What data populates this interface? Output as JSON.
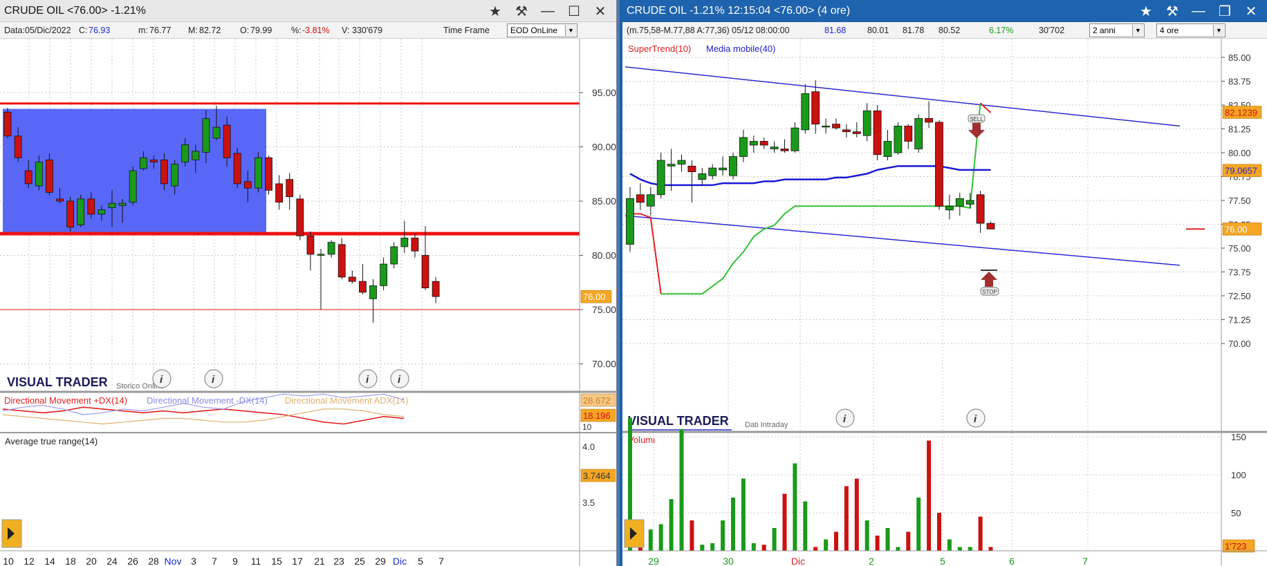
{
  "left": {
    "title": "CRUDE OIL <76.00> -1.21%",
    "info": {
      "data_label": "Data:05/Dic/2022",
      "close_label": "C:",
      "close": "76.93",
      "min_label": "m:",
      "min": "76.77",
      "max_label": "M:",
      "max": "82.72",
      "open_label": "O:",
      "open": "79.99",
      "pct_label": "%:",
      "pct": "-3.81%",
      "vol_label": "V:",
      "vol": "330'679",
      "timeframe_label": "Time Frame",
      "timeframe_value": "EOD OnLine"
    },
    "price_axis": [
      "95.00",
      "90.00",
      "85.00",
      "80.00",
      "75.00",
      "70.00"
    ],
    "price_badge": "76.00",
    "brand": "VISUAL TRADER",
    "brand_sub": "Storico Online",
    "dmi": {
      "plus_label": "Directional Movement +DX(14)",
      "minus_label": "Directional Movement -DX(14)",
      "adx_label": "Directional Movement ADX(14)",
      "badge_top": "28.672",
      "badge_mid": "18.196",
      "axis_10": "10"
    },
    "atr": {
      "label": "Average true range(14)",
      "axis": [
        "4.0",
        "3.5"
      ],
      "badge": "3.7464"
    },
    "x_axis": [
      "10",
      "12",
      "14",
      "18",
      "20",
      "24",
      "26",
      "28",
      "Nov",
      "3",
      "7",
      "9",
      "11",
      "15",
      "17",
      "21",
      "23",
      "25",
      "29",
      "Dic",
      "5",
      "7"
    ],
    "colors": {
      "up": "#1a9a1a",
      "down": "#cc1111",
      "range_box": "#4a5af5",
      "level": "#ee1111",
      "badge": "#f5a623"
    }
  },
  "right": {
    "title": "CRUDE OIL -1.21% 12:15:04  <76.00> (4 ore)",
    "info": {
      "summary": "(m.75,58-M.77,88 A:77,36) 05/12 08:00:00",
      "last": "81.68",
      "v1": "80.01",
      "v2": "81.78",
      "v3": "80.52",
      "pct": "6.17%",
      "vol": "30'702",
      "period_value": "2 anni",
      "interval_value": "4 ore"
    },
    "legend_supertrend": "SuperTrend(10)",
    "legend_ma": "Media mobile(40)",
    "price_axis": [
      "85.00",
      "83.75",
      "82.50",
      "81.25",
      "80.00",
      "78.75",
      "77.50",
      "76.25",
      "75.00",
      "73.75",
      "72.50",
      "71.25",
      "70.00"
    ],
    "badge_top": "82.1239",
    "badge_mid": "79.0657",
    "badge_price": "76.00",
    "sell_label": "SELL",
    "stop_label": "STOP",
    "brand": "VISUAL TRADER",
    "brand_sub": "Dati Intraday",
    "volume_label": "Volumi",
    "volume_axis": [
      "150",
      "100",
      "50"
    ],
    "volume_badge": "1'723",
    "x_axis": [
      "29",
      "30",
      "Dic",
      "2",
      "5",
      "6",
      "7"
    ]
  },
  "chart_data": [
    {
      "type": "candlestick",
      "title": "CRUDE OIL <76.00> -1.21%",
      "x_labels": [
        "10",
        "12",
        "14",
        "18",
        "20",
        "24",
        "26",
        "28",
        "Nov",
        "3",
        "7",
        "9",
        "11",
        "15",
        "17",
        "21",
        "23",
        "25",
        "29",
        "Dic",
        "5",
        "7"
      ],
      "ylim": [
        67.5,
        98.5
      ],
      "levels": [
        94.0,
        82.0,
        75.0
      ],
      "range_box": {
        "from_index": 0,
        "to_index": 24,
        "low": 82.1,
        "high": 93.5
      },
      "ohlc": [
        [
          93.2,
          93.6,
          90.8,
          91.0
        ],
        [
          91.0,
          91.8,
          88.6,
          89.0
        ],
        [
          87.8,
          88.8,
          86.2,
          86.6
        ],
        [
          86.4,
          89.2,
          86.0,
          88.6
        ],
        [
          88.8,
          89.4,
          85.5,
          85.8
        ],
        [
          85.2,
          86.2,
          84.8,
          85.0
        ],
        [
          85.0,
          85.4,
          82.2,
          82.6
        ],
        [
          82.8,
          85.6,
          82.6,
          85.2
        ],
        [
          85.2,
          85.8,
          83.4,
          83.8
        ],
        [
          83.8,
          84.6,
          83.2,
          84.2
        ],
        [
          84.4,
          86.0,
          82.6,
          84.8
        ],
        [
          84.6,
          85.2,
          83.0,
          84.8
        ],
        [
          84.9,
          88.2,
          84.6,
          87.8
        ],
        [
          88.0,
          89.6,
          87.8,
          89.0
        ],
        [
          88.8,
          89.2,
          88.0,
          88.6
        ],
        [
          88.8,
          89.4,
          86.0,
          86.6
        ],
        [
          86.4,
          88.8,
          85.6,
          88.4
        ],
        [
          88.6,
          90.8,
          88.2,
          90.2
        ],
        [
          88.8,
          90.2,
          87.6,
          89.6
        ],
        [
          89.5,
          93.4,
          88.5,
          92.6
        ],
        [
          90.8,
          93.8,
          90.6,
          91.8
        ],
        [
          92.0,
          92.8,
          88.2,
          89.0
        ],
        [
          89.4,
          89.9,
          86.2,
          86.6
        ],
        [
          86.8,
          87.8,
          84.9,
          86.2
        ],
        [
          86.2,
          89.5,
          85.8,
          89.0
        ],
        [
          89.0,
          89.2,
          85.6,
          86.0
        ],
        [
          86.6,
          87.4,
          84.2,
          84.9
        ],
        [
          87.0,
          87.6,
          84.2,
          85.4
        ],
        [
          85.2,
          85.6,
          81.4,
          81.8
        ],
        [
          81.8,
          82.2,
          78.6,
          80.1
        ],
        [
          80.0,
          80.6,
          75.0,
          80.1
        ],
        [
          80.1,
          81.4,
          79.8,
          81.2
        ],
        [
          81.0,
          81.6,
          77.8,
          78.0
        ],
        [
          78.0,
          78.6,
          77.4,
          77.6
        ],
        [
          77.6,
          79.2,
          76.4,
          76.6
        ],
        [
          76.0,
          77.8,
          73.8,
          77.2
        ],
        [
          77.2,
          79.8,
          76.8,
          79.2
        ],
        [
          79.2,
          81.2,
          78.8,
          80.8
        ],
        [
          80.8,
          83.2,
          80.2,
          81.6
        ],
        [
          81.6,
          82.0,
          79.8,
          80.4
        ],
        [
          80.0,
          82.7,
          76.8,
          77.0
        ],
        [
          77.6,
          78.0,
          75.6,
          76.2
        ]
      ]
    },
    {
      "type": "line",
      "title": "Directional Movement",
      "series": [
        {
          "name": "Directional Movement +DX(14)",
          "values": [
            23,
            22,
            21,
            22,
            24,
            23,
            22,
            21,
            22,
            21,
            22,
            23,
            22,
            21,
            20,
            18,
            16,
            15,
            17,
            19,
            18
          ]
        },
        {
          "name": "Directional Movement -DX(14)",
          "values": [
            22,
            24,
            25,
            23,
            20,
            21,
            23,
            22,
            24,
            26,
            24,
            23,
            27,
            29,
            31,
            30,
            31,
            29,
            30,
            31,
            28
          ]
        },
        {
          "name": "Directional Movement ADX(14)",
          "values": [
            20,
            19,
            18,
            17,
            16,
            15,
            16,
            17,
            18,
            18,
            17,
            16,
            16,
            17,
            19,
            21,
            23,
            23,
            22,
            20,
            19
          ]
        }
      ]
    },
    {
      "type": "candlestick",
      "title": "CRUDE OIL -1.21% 12:15:04  <76.00> (4 ore)",
      "x_labels": [
        "29",
        "30",
        "Dic",
        "2",
        "5",
        "6",
        "7"
      ],
      "ylim": [
        69.0,
        85.6
      ],
      "ohlc": [
        [
          75.2,
          78.2,
          74.8,
          77.6
        ],
        [
          77.8,
          78.4,
          77.0,
          77.4
        ],
        [
          77.2,
          78.2,
          76.7,
          77.8
        ],
        [
          77.8,
          80.0,
          77.6,
          79.6
        ],
        [
          79.3,
          80.2,
          78.0,
          79.4
        ],
        [
          79.4,
          79.9,
          79.0,
          79.6
        ],
        [
          79.3,
          79.6,
          77.4,
          79.0
        ],
        [
          78.6,
          79.2,
          78.3,
          78.9
        ],
        [
          78.8,
          79.4,
          78.6,
          79.2
        ],
        [
          79.1,
          79.8,
          78.8,
          79.2
        ],
        [
          78.8,
          80.0,
          78.6,
          79.8
        ],
        [
          79.8,
          81.2,
          79.5,
          80.8
        ],
        [
          80.4,
          80.9,
          80.0,
          80.6
        ],
        [
          80.6,
          80.8,
          80.2,
          80.4
        ],
        [
          80.2,
          80.6,
          80.0,
          80.3
        ],
        [
          80.2,
          80.7,
          80.0,
          80.1
        ],
        [
          80.1,
          81.6,
          80.0,
          81.3
        ],
        [
          81.2,
          83.6,
          81.0,
          83.1
        ],
        [
          83.2,
          83.8,
          81.0,
          81.5
        ],
        [
          81.4,
          81.8,
          81.0,
          81.4
        ],
        [
          81.5,
          81.8,
          81.2,
          81.3
        ],
        [
          81.2,
          81.5,
          80.8,
          81.1
        ],
        [
          81.1,
          81.6,
          80.8,
          81.0
        ],
        [
          80.9,
          82.6,
          80.6,
          82.2
        ],
        [
          82.2,
          82.5,
          79.6,
          79.9
        ],
        [
          79.8,
          81.2,
          79.6,
          80.6
        ],
        [
          80.0,
          81.6,
          79.9,
          81.4
        ],
        [
          81.4,
          81.5,
          80.2,
          80.6
        ],
        [
          80.2,
          82.0,
          80.0,
          81.8
        ],
        [
          81.8,
          82.7,
          81.3,
          81.6
        ],
        [
          81.6,
          81.7,
          77.0,
          77.2
        ],
        [
          77.0,
          77.8,
          76.5,
          77.2
        ],
        [
          77.2,
          77.9,
          76.7,
          77.6
        ],
        [
          77.3,
          77.9,
          77.1,
          77.5
        ],
        [
          77.8,
          78.0,
          75.8,
          76.3
        ],
        [
          76.3,
          76.4,
          76.0,
          76.0
        ]
      ],
      "series": [
        {
          "name": "SuperTrend(10)",
          "values": [
            76.8,
            76.8,
            76.6,
            72.6,
            72.6,
            72.6,
            72.6,
            72.6,
            73.0,
            73.4,
            74.2,
            74.8,
            75.6,
            76.0,
            76.2,
            76.8,
            77.2,
            77.2,
            77.2,
            77.2,
            77.2,
            77.2,
            77.2,
            77.2,
            77.2,
            77.2,
            77.2,
            77.2,
            77.2,
            77.2,
            77.2,
            77.2,
            77.2,
            77.1,
            82.6,
            82.1
          ]
        },
        {
          "name": "Media mobile(40)",
          "values": [
            78.9,
            78.6,
            78.4,
            78.3,
            78.3,
            78.3,
            78.3,
            78.3,
            78.3,
            78.4,
            78.4,
            78.4,
            78.4,
            78.5,
            78.5,
            78.6,
            78.6,
            78.6,
            78.6,
            78.6,
            78.7,
            78.7,
            78.8,
            78.9,
            79.1,
            79.2,
            79.3,
            79.3,
            79.3,
            79.3,
            79.3,
            79.2,
            79.1,
            79.1,
            79.1,
            79.1
          ]
        }
      ],
      "volume": [
        175,
        15,
        28,
        35,
        68,
        160,
        40,
        8,
        10,
        40,
        70,
        95,
        10,
        8,
        30,
        75,
        115,
        65,
        5,
        15,
        25,
        85,
        95,
        40,
        20,
        30,
        5,
        25,
        70,
        145,
        50,
        15,
        5,
        5,
        45,
        5
      ]
    }
  ]
}
